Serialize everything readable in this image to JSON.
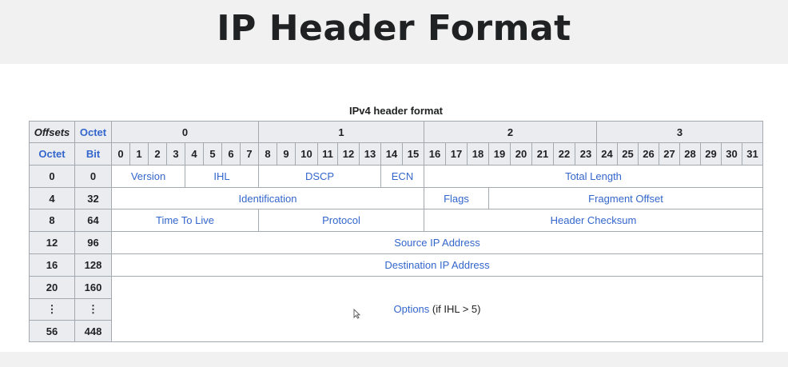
{
  "title": "IP Header Format",
  "caption": "IPv4 header format",
  "corner": {
    "offsets": "Offsets",
    "octet": "Octet",
    "octet2": "Octet",
    "bit": "Bit"
  },
  "octets": [
    "0",
    "1",
    "2",
    "3"
  ],
  "bits": [
    "0",
    "1",
    "2",
    "3",
    "4",
    "5",
    "6",
    "7",
    "8",
    "9",
    "10",
    "11",
    "12",
    "13",
    "14",
    "15",
    "16",
    "17",
    "18",
    "19",
    "20",
    "21",
    "22",
    "23",
    "24",
    "25",
    "26",
    "27",
    "28",
    "29",
    "30",
    "31"
  ],
  "rows": [
    {
      "octet": "0",
      "bit": "0"
    },
    {
      "octet": "4",
      "bit": "32"
    },
    {
      "octet": "8",
      "bit": "64"
    },
    {
      "octet": "12",
      "bit": "96"
    },
    {
      "octet": "16",
      "bit": "128"
    },
    {
      "octet": "20",
      "bit": "160"
    },
    {
      "octet": "⋮",
      "bit": "⋮"
    },
    {
      "octet": "56",
      "bit": "448"
    }
  ],
  "fields": {
    "version": "Version",
    "ihl": "IHL",
    "dscp": "DSCP",
    "ecn": "ECN",
    "total_length": "Total Length",
    "identification": "Identification",
    "flags": "Flags",
    "fragment_offset": "Fragment Offset",
    "ttl": "Time To Live",
    "protocol": "Protocol",
    "header_checksum": "Header Checksum",
    "source_ip": "Source IP Address",
    "destination_ip": "Destination IP Address",
    "options": "Options",
    "options_note": "(if IHL > 5)"
  }
}
